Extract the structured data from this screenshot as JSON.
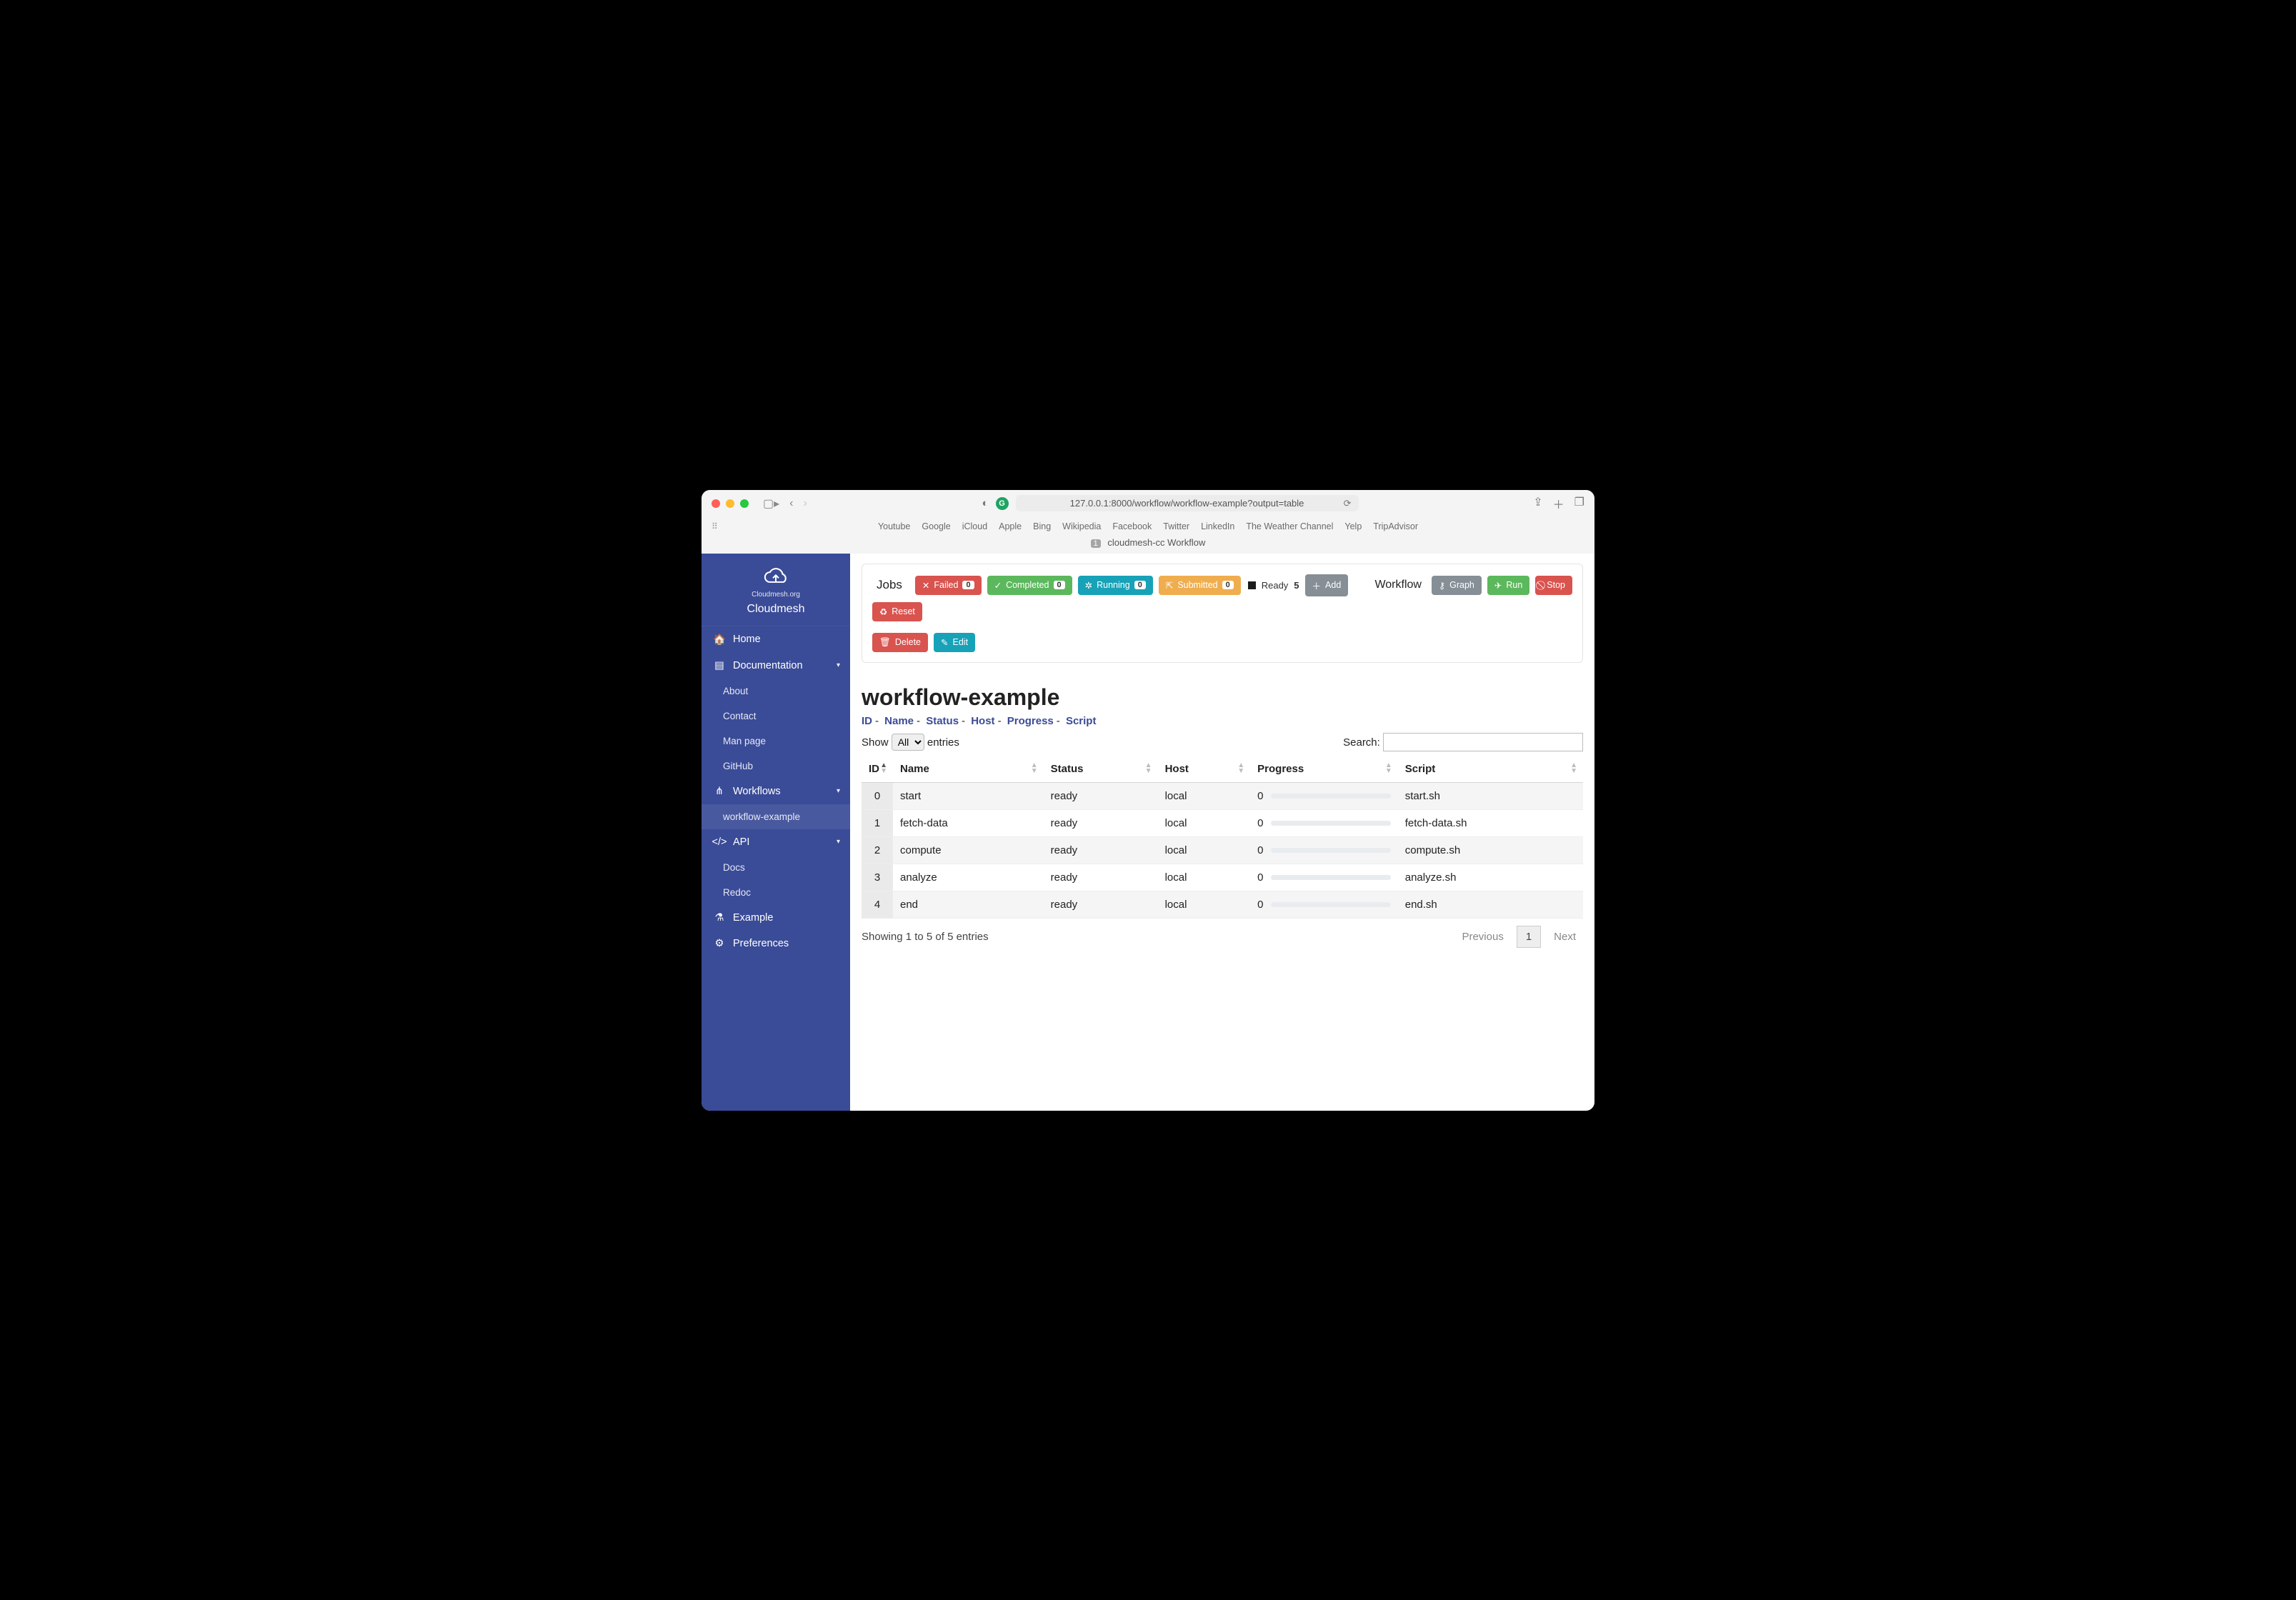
{
  "browser": {
    "url": "127.0.0.1:8000/workflow/workflow-example?output=table",
    "bookmarks": [
      "Youtube",
      "Google",
      "iCloud",
      "Apple",
      "Bing",
      "Wikipedia",
      "Facebook",
      "Twitter",
      "LinkedIn",
      "The Weather Channel",
      "Yelp",
      "TripAdvisor"
    ],
    "tab": {
      "badge": "1",
      "title": "cloudmesh-cc Workflow"
    }
  },
  "brand": {
    "org": "Cloudmesh.org",
    "name": "Cloudmesh"
  },
  "sidebar": {
    "home": "Home",
    "documentation": {
      "label": "Documentation",
      "items": [
        "About",
        "Contact",
        "Man page",
        "GitHub"
      ]
    },
    "workflows": {
      "label": "Workflows",
      "items": [
        "workflow-example"
      ]
    },
    "api": {
      "label": "API",
      "items": [
        "Docs",
        "Redoc"
      ]
    },
    "example": "Example",
    "preferences": "Preferences"
  },
  "panel": {
    "jobs_label": "Jobs",
    "failed": {
      "label": "Failed",
      "count": "0"
    },
    "completed": {
      "label": "Completed",
      "count": "0"
    },
    "running": {
      "label": "Running",
      "count": "0"
    },
    "submitted": {
      "label": "Submitted",
      "count": "0"
    },
    "ready": {
      "label": "Ready",
      "count": "5"
    },
    "add": "Add",
    "delete": "Delete",
    "edit": "Edit",
    "workflow_label": "Workflow",
    "graph": "Graph",
    "run": "Run",
    "stop": "Stop",
    "reset": "Reset"
  },
  "page": {
    "title": "workflow-example",
    "crumbs": [
      "ID",
      "Name",
      "Status",
      "Host",
      "Progress",
      "Script"
    ],
    "show_prefix": "Show",
    "show_suffix": "entries",
    "show_value": "All",
    "search_label": "Search:",
    "columns": [
      "ID",
      "Name",
      "Status",
      "Host",
      "Progress",
      "Script"
    ],
    "rows": [
      {
        "id": "0",
        "name": "start",
        "status": "ready",
        "host": "local",
        "progress": "0",
        "script": "start.sh"
      },
      {
        "id": "1",
        "name": "fetch-data",
        "status": "ready",
        "host": "local",
        "progress": "0",
        "script": "fetch-data.sh"
      },
      {
        "id": "2",
        "name": "compute",
        "status": "ready",
        "host": "local",
        "progress": "0",
        "script": "compute.sh"
      },
      {
        "id": "3",
        "name": "analyze",
        "status": "ready",
        "host": "local",
        "progress": "0",
        "script": "analyze.sh"
      },
      {
        "id": "4",
        "name": "end",
        "status": "ready",
        "host": "local",
        "progress": "0",
        "script": "end.sh"
      }
    ],
    "footer_info": "Showing 1 to 5 of 5 entries",
    "prev": "Previous",
    "next": "Next",
    "page_num": "1"
  }
}
